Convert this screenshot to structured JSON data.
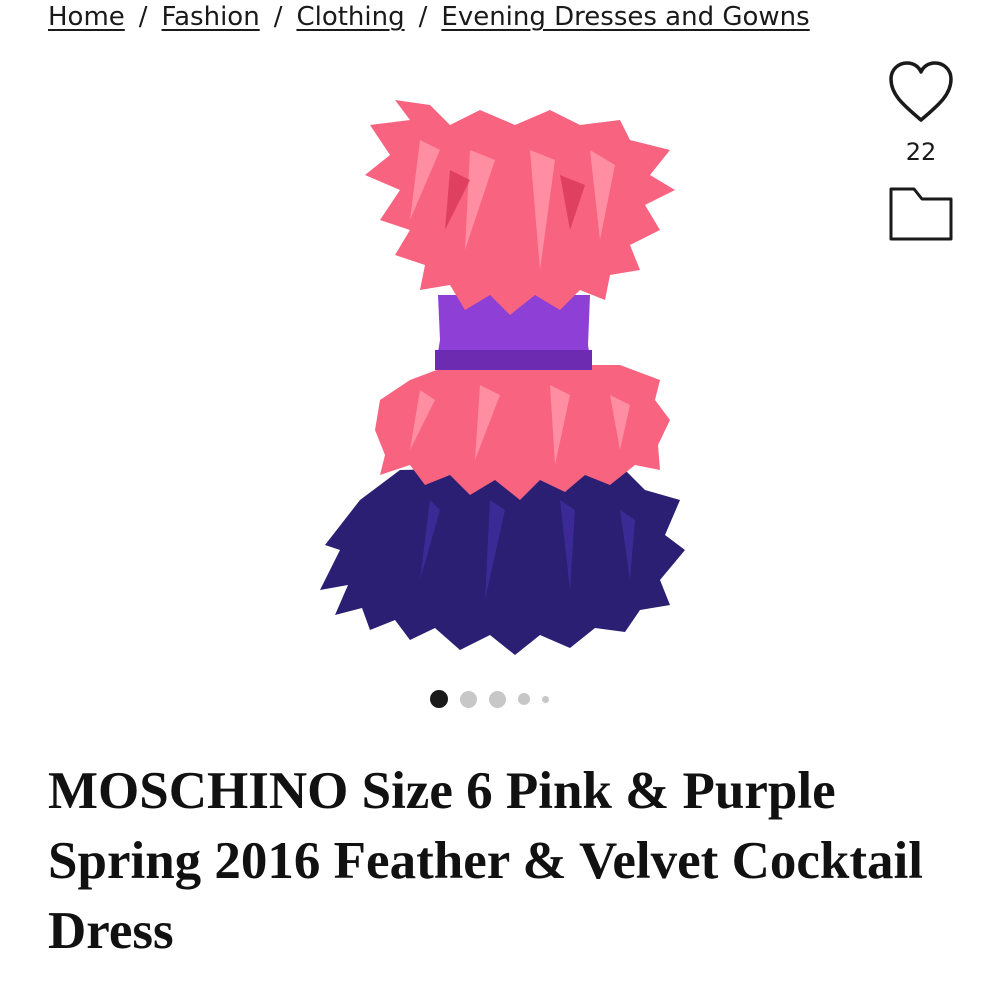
{
  "breadcrumb": {
    "items": [
      "Home",
      "Fashion",
      "Clothing",
      "Evening Dresses and Gowns"
    ],
    "separator": "/"
  },
  "actions": {
    "favorite_icon": "heart-icon",
    "favorite_count": "22",
    "collection_icon": "folder-icon"
  },
  "carousel": {
    "total_dots": 5,
    "active_index": 0
  },
  "product": {
    "title": "MOSCHINO Size 6 Pink & Purple Spring 2016 Feather & Velvet Cocktail Dress",
    "image_colors": {
      "pink_feathers": "#f8637f",
      "purple_velvet": "#8e3fd6",
      "navy_feathers": "#2a1f72"
    }
  }
}
